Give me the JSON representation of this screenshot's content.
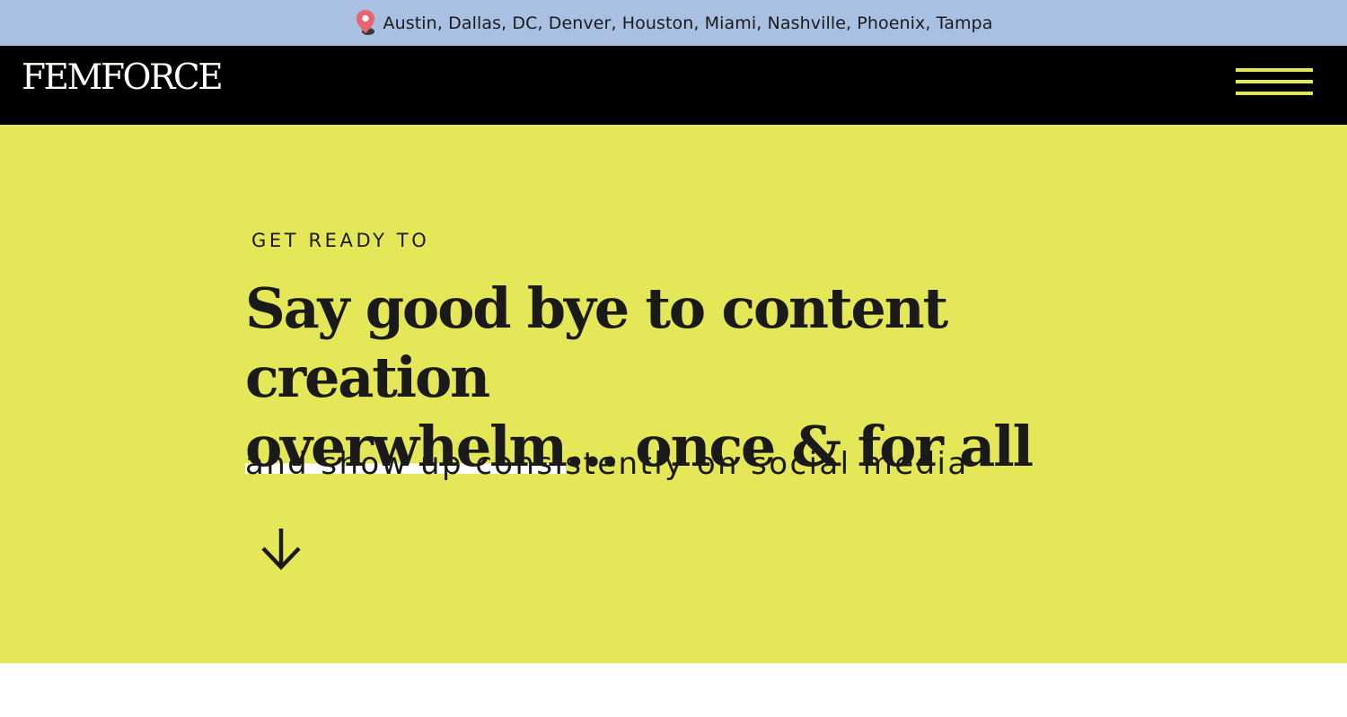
{
  "topbar": {
    "icon": "map-pin-icon",
    "cities": "Austin, Dallas, DC, Denver, Houston, Miami, Nashville, Phoenix, Tampa",
    "background": "#aac0e2",
    "pin_color": "#e8646e"
  },
  "nav": {
    "logo": "FEMFORCE",
    "menu_icon": "hamburger-menu-icon",
    "background": "#000000",
    "accent": "#e3e75a"
  },
  "hero": {
    "background": "#e3e758",
    "eyebrow": "GET READY TO",
    "headline_line1": "Say good bye to content creation",
    "headline_highlight": "overwhelm",
    "headline_rest": "... once & for all",
    "subhead": "and show up consistently on social media",
    "scroll_icon": "arrow-down-icon"
  }
}
